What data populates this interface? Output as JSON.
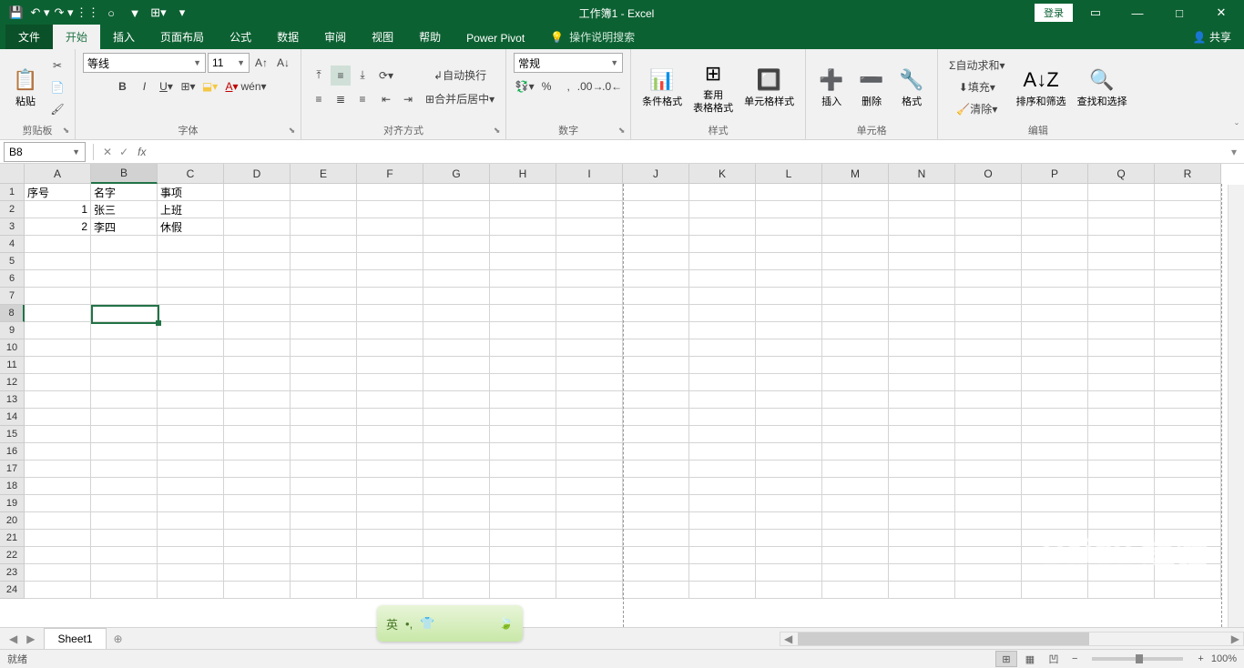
{
  "app": {
    "title": "工作簿1  -  Excel",
    "login": "登录",
    "share": "共享"
  },
  "qat": {
    "save": "💾",
    "undo": "↶",
    "redo": "↷"
  },
  "tabs": {
    "file": "文件",
    "home": "开始",
    "insert": "插入",
    "layout": "页面布局",
    "formulas": "公式",
    "data": "数据",
    "review": "审阅",
    "view": "视图",
    "help": "帮助",
    "powerpivot": "Power Pivot",
    "tellme": "操作说明搜索"
  },
  "ribbon": {
    "clipboard": {
      "label": "剪贴板",
      "paste": "粘贴"
    },
    "font": {
      "label": "字体",
      "name": "等线",
      "size": "11"
    },
    "align": {
      "label": "对齐方式",
      "wrap": "自动换行",
      "merge": "合并后居中"
    },
    "number": {
      "label": "数字",
      "format": "常规"
    },
    "styles": {
      "label": "样式",
      "cond": "条件格式",
      "table": "套用\n表格格式",
      "cell": "单元格样式"
    },
    "cells": {
      "label": "单元格",
      "insert": "插入",
      "delete": "删除",
      "format": "格式"
    },
    "editing": {
      "label": "编辑",
      "sum": "自动求和",
      "fill": "填充",
      "clear": "清除",
      "sort": "排序和筛选",
      "find": "查找和选择"
    }
  },
  "namebox": "B8",
  "columns": [
    "A",
    "B",
    "C",
    "D",
    "E",
    "F",
    "G",
    "H",
    "I",
    "J",
    "K",
    "L",
    "M",
    "N",
    "O",
    "P",
    "Q",
    "R"
  ],
  "rows": [
    "1",
    "2",
    "3",
    "4",
    "5",
    "6",
    "7",
    "8",
    "9",
    "10",
    "11",
    "12",
    "13",
    "14",
    "15",
    "16",
    "17",
    "18",
    "19",
    "20",
    "21",
    "22",
    "23",
    "24"
  ],
  "cells": {
    "A1": "序号",
    "B1": "名字",
    "C1": "事项",
    "A2": "1",
    "B2": "张三",
    "C2": "上班",
    "A3": "2",
    "B3": "李四",
    "C3": "休假"
  },
  "sheet": {
    "name": "Sheet1"
  },
  "status": {
    "ready": "就绪",
    "zoom": "100%"
  },
  "ime": {
    "lang": "英"
  },
  "watermark": "Baidu 经验"
}
